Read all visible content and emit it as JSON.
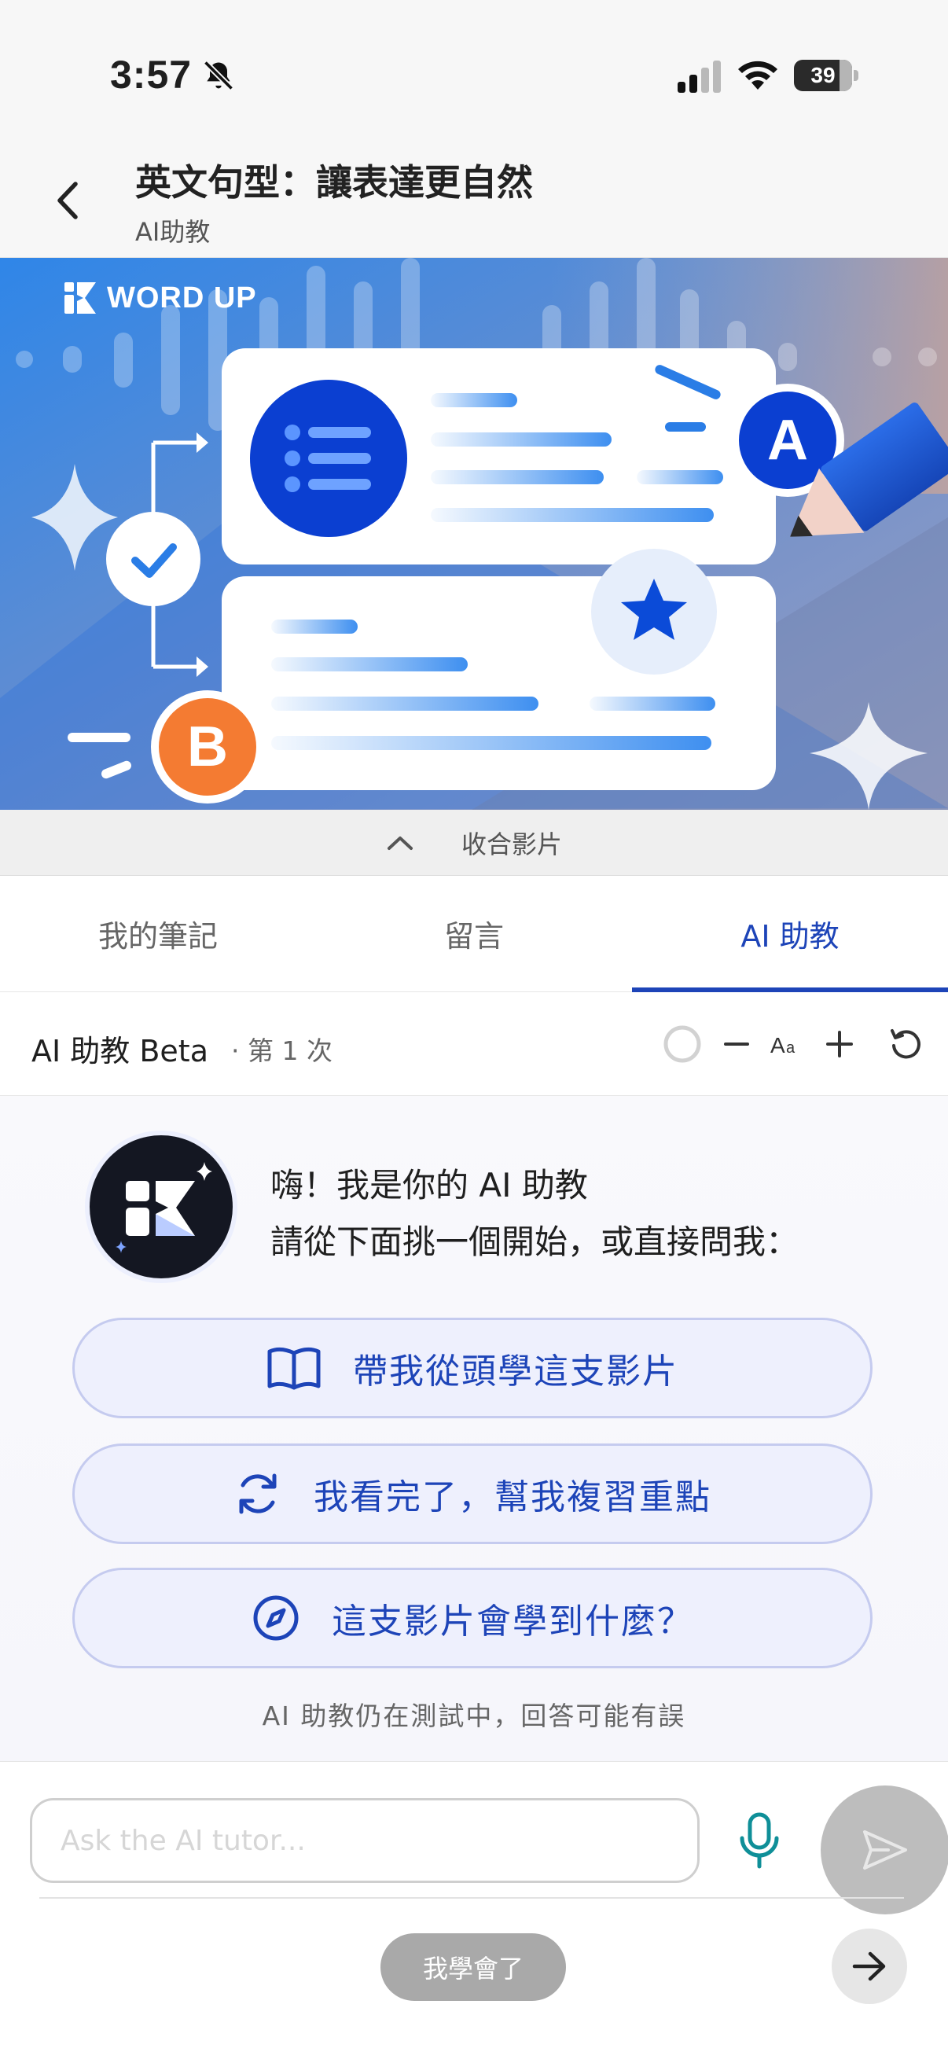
{
  "status_bar": {
    "time": "3:57",
    "battery": "39"
  },
  "header": {
    "title": "英文句型：讓表達更自然",
    "subtitle": "AI助教"
  },
  "video": {
    "brand": "WORD UP"
  },
  "collapse": {
    "label": "收合影片"
  },
  "tabs": [
    {
      "label": "我的筆記",
      "active": false
    },
    {
      "label": "留言",
      "active": false
    },
    {
      "label": "AI 助教",
      "active": true
    }
  ],
  "ai_header": {
    "title": "AI 助教 Beta",
    "count": "· 第 1 次"
  },
  "chat": {
    "greeting_line1": "嗨！我是你的 AI 助教",
    "greeting_line2": "請從下面挑一個開始，或直接問我：",
    "suggestions": [
      {
        "label": "帶我從頭學這支影片",
        "icon": "book-open-icon"
      },
      {
        "label": "我看完了，幫我複習重點",
        "icon": "refresh-icon"
      },
      {
        "label": "這支影片會學到什麼？",
        "icon": "compass-icon"
      }
    ],
    "disclaimer": "AI 助教仍在測試中，回答可能有誤"
  },
  "input": {
    "placeholder": "Ask the AI tutor...",
    "value": ""
  },
  "footer": {
    "learned_label": "我學會了"
  },
  "colors": {
    "accent": "#1d44b8",
    "pill_bg": "#eef0fd",
    "pill_border": "#c5cbef",
    "badge_a": "#0b3fd1",
    "badge_b": "#f47b32"
  }
}
